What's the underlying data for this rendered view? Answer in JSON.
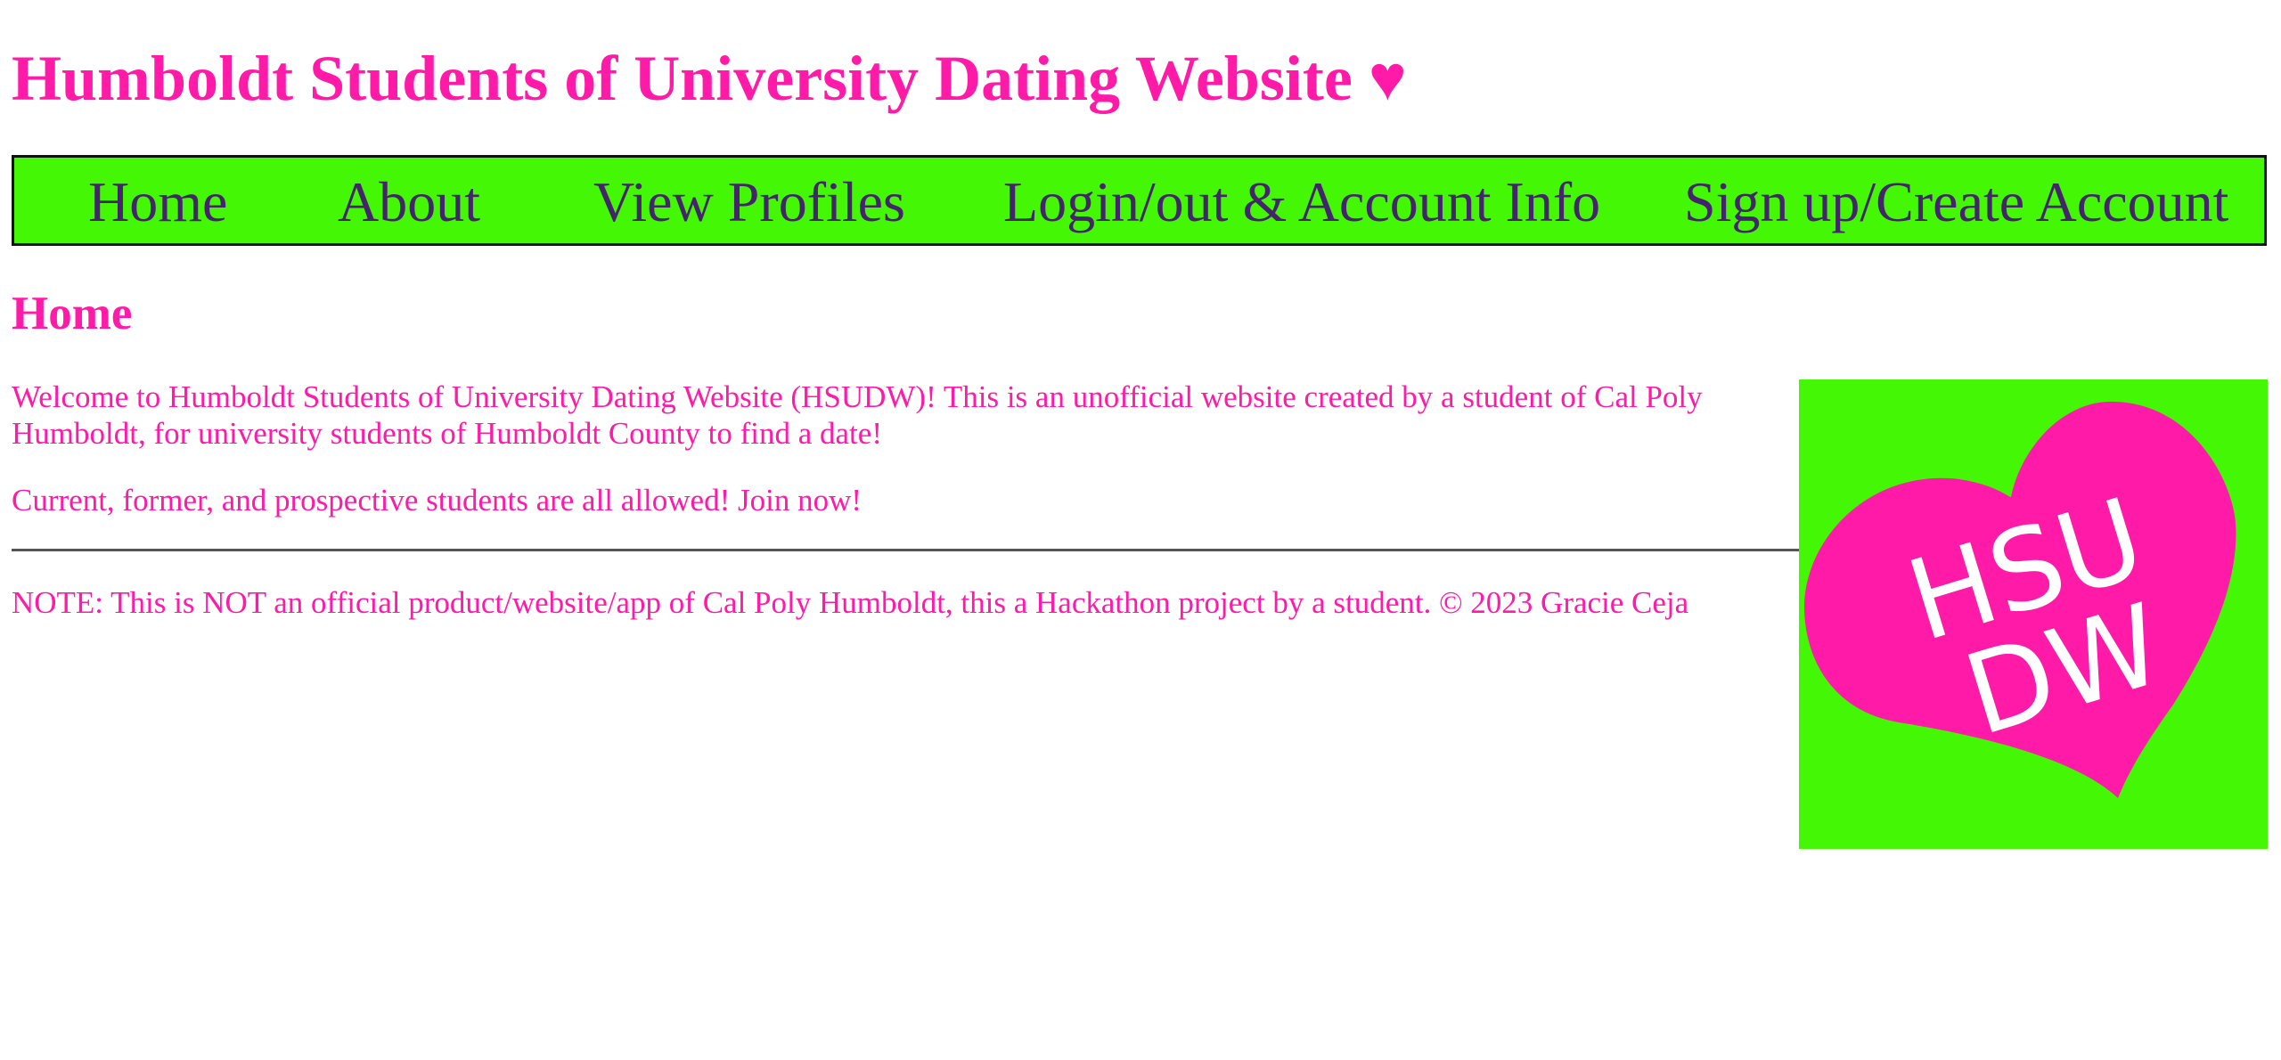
{
  "header": {
    "title": "Humboldt Students of University Dating Website ♥"
  },
  "nav": {
    "items": [
      {
        "label": "Home"
      },
      {
        "label": "About"
      },
      {
        "label": "View Profiles"
      },
      {
        "label": "Login/out & Account Info"
      },
      {
        "label": "Sign up/Create Account"
      }
    ]
  },
  "main": {
    "heading": "Home",
    "intro": "Welcome to Humboldt Students of University Dating Website (HSUDW)! This is an unofficial website created by a student of Cal Poly Humboldt, for university students of Humboldt County to find a date!",
    "join": "Current, former, and prospective students are all allowed! Join now!",
    "note": "NOTE: This is NOT an official product/website/app of Cal Poly Humboldt, this a Hackathon project by a student. © 2023 Gracie Ceja"
  },
  "logo": {
    "line1": "HSU",
    "line2": "DW",
    "icon": "heart-logo-icon"
  },
  "colors": {
    "accent_pink": "#ff1aa8",
    "nav_green": "#44f705",
    "nav_text": "#44246b"
  }
}
